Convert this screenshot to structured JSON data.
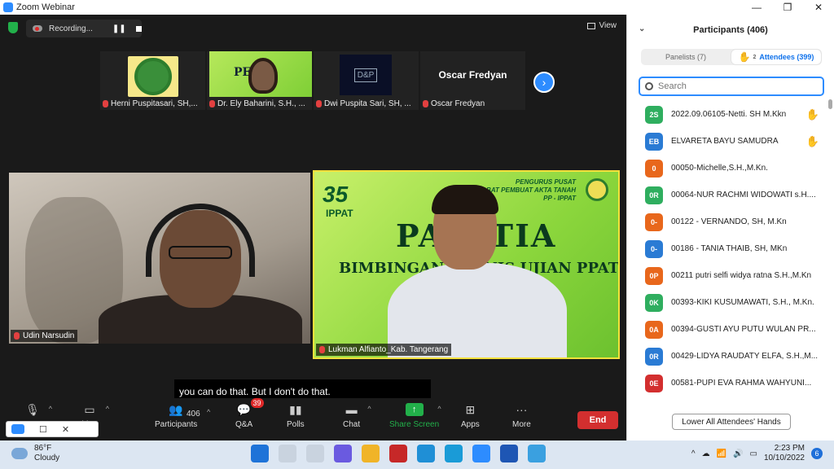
{
  "window": {
    "title": "Zoom Webinar",
    "minimize": "—",
    "maximize": "❐",
    "close": "✕"
  },
  "topbar": {
    "recording_label": "Recording...",
    "view_label": "View"
  },
  "thumbnails": [
    {
      "name": "Herni Puspitasari, SH,..."
    },
    {
      "name": "Dr. Ely Baharini, S.H., ...",
      "slide_text": "PEM"
    },
    {
      "name": "Dwi Puspita Sari, SH, ...",
      "logo_text": "D&P"
    },
    {
      "name": "Oscar Fredyan",
      "big_name": "Oscar Fredyan"
    }
  ],
  "videos": {
    "left_name": "Udin Narsudin",
    "right_name": "Lukman Alfianto_Kab. Tangerang",
    "slide": {
      "anniv": "35",
      "org": "IPPAT",
      "header": "PENGURUS PUSAT\nIKATAN PEJABAT PEMBUAT AKTA TANAH\nPP - IPPAT",
      "title": "PANITIA",
      "subtitle": "BIMBINGAN TEKNIS UJIAN PPAT"
    }
  },
  "caption": "you can do that. But I don't do that.",
  "toolbar": {
    "video": "ideo",
    "participants_count": "406",
    "participants": "Participants",
    "qa_badge": "39",
    "qa": "Q&A",
    "polls": "Polls",
    "chat": "Chat",
    "share": "Share Screen",
    "apps": "Apps",
    "more": "More",
    "end": "End"
  },
  "panel": {
    "title": "Participants (406)",
    "tab_panelists": "Panelists (7)",
    "tab_attendees": "Attendees (399)",
    "hand_count": "2",
    "search_placeholder": "Search",
    "lower_hands": "Lower All Attendees' Hands",
    "attendees": [
      {
        "initials": "2S",
        "name": "2022.09.06105-Netti. SH M.Kkn",
        "color": "#2fae5f",
        "hand": true
      },
      {
        "initials": "EB",
        "name": "ELVARETA BAYU SAMUDRA",
        "color": "#2a7bd4",
        "hand": true
      },
      {
        "initials": "0",
        "name": "00050-Michelle,S.H.,M.Kn.",
        "color": "#e8671c",
        "hand": false
      },
      {
        "initials": "0R",
        "name": "00064-NUR RACHMI WIDOWATI s.H....",
        "color": "#2fae5f",
        "hand": false
      },
      {
        "initials": "0-",
        "name": "00122 - VERNANDO, SH, M.Kn",
        "color": "#e8671c",
        "hand": false
      },
      {
        "initials": "0-",
        "name": "00186 - TANIA THAIB, SH, MKn",
        "color": "#2a7bd4",
        "hand": false
      },
      {
        "initials": "0P",
        "name": "00211 putri selfi widya ratna S.H.,M.Kn",
        "color": "#e8671c",
        "hand": false
      },
      {
        "initials": "0K",
        "name": "00393-KIKI KUSUMAWATI, S.H., M.Kn.",
        "color": "#2fae5f",
        "hand": false
      },
      {
        "initials": "0A",
        "name": "00394-GUSTI AYU PUTU WULAN PR...",
        "color": "#e8671c",
        "hand": false
      },
      {
        "initials": "0R",
        "name": "00429-LIDYA RAUDATY ELFA, S.H.,M...",
        "color": "#2a7bd4",
        "hand": false
      },
      {
        "initials": "0E",
        "name": "00581-PUPI EVA RAHMA WAHYUNI...",
        "color": "#d32f2f",
        "hand": false
      }
    ]
  },
  "taskbar": {
    "temp": "86°F",
    "weather": "Cloudy",
    "time": "2:23 PM",
    "date": "10/10/2022",
    "notif": "6"
  }
}
